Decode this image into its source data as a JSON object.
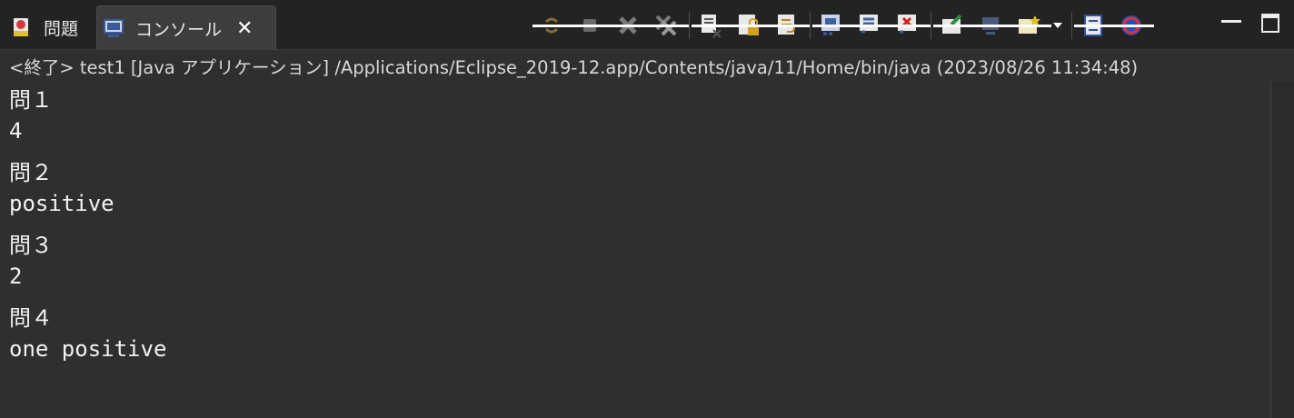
{
  "tabs": [
    {
      "label": "問題",
      "icon": "problems-icon"
    },
    {
      "label": "コンソール",
      "icon": "console-icon",
      "close": "✕"
    }
  ],
  "toolbar": {
    "buttons": [
      "relaunch-icon",
      "terminate-icon",
      "remove-launch-icon",
      "remove-all-terminated-icon",
      "clear-console-icon",
      "scroll-lock-icon",
      "word-wrap-icon",
      "show-on-output-icon",
      "show-on-error-icon",
      "show-stderr-icon",
      "pin-console-icon",
      "display-console-icon",
      "open-console-icon",
      "view-menu-icon",
      "debug-icon"
    ]
  },
  "status": "<終了> test1 [Java アプリケーション] /Applications/Eclipse_2019-12.app/Contents/java/11/Home/bin/java (2023/08/26 11:34:48)",
  "output": [
    "問１",
    "4",
    "問２",
    "positive",
    "問３",
    "2",
    "問４",
    "one positive"
  ],
  "colors": {
    "background": "#2f2f2f",
    "tabbar": "#232323",
    "text": "#f2f2f2"
  }
}
